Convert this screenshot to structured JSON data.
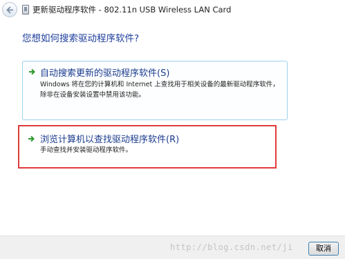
{
  "window": {
    "title": "更新驱动程序软件 - 802.11n USB Wireless LAN Card"
  },
  "main": {
    "question": "您想如何搜索驱动程序软件?",
    "options": [
      {
        "title": "自动搜索更新的驱动程序软件(S)",
        "description": "Windows 将在您的计算机和 Internet 上查找用于相关设备的最新驱动程序软件，除非在设备安装设置中禁用该功能。",
        "icon": "green-arrow-icon"
      },
      {
        "title": "浏览计算机以查找驱动程序软件(R)",
        "description": "手动查找并安装驱动程序软件。",
        "icon": "green-arrow-icon",
        "highlight_color": "#e03a3a"
      }
    ]
  },
  "footer": {
    "watermark": "http://blog.csdn.net/ji",
    "cancel_label": "取消"
  }
}
